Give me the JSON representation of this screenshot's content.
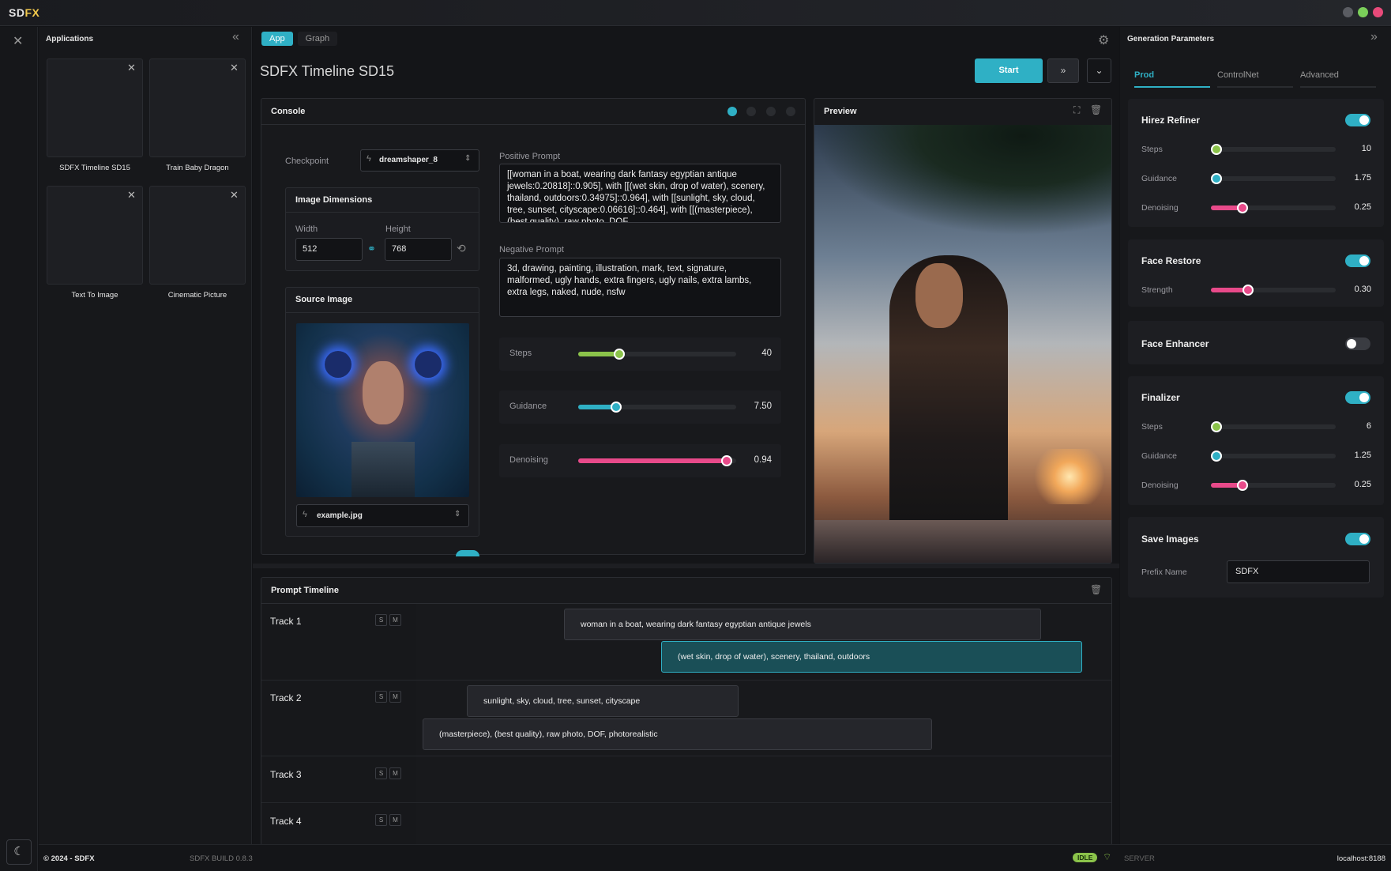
{
  "app": {
    "logo_sd": "SD",
    "logo_fx": "FX"
  },
  "window_controls": {
    "colors": [
      "#5a5c62",
      "#7bcf5a",
      "#e84a7a"
    ]
  },
  "applications": {
    "title": "Applications",
    "items": [
      {
        "label": "SDFX Timeline SD15"
      },
      {
        "label": "Train Baby Dragon"
      },
      {
        "label": "Text To Image"
      },
      {
        "label": "Cinematic Picture"
      }
    ]
  },
  "main": {
    "tabs": [
      {
        "label": "App"
      },
      {
        "label": "Graph"
      }
    ],
    "title": "SDFX Timeline SD15",
    "start_label": "Start"
  },
  "console": {
    "title": "Console",
    "checkpoint_label": "Checkpoint",
    "checkpoint_value": "dreamshaper_8",
    "image_dimensions": {
      "title": "Image Dimensions",
      "width_label": "Width",
      "width_value": "512",
      "height_label": "Height",
      "height_value": "768"
    },
    "source_image": {
      "title": "Source Image",
      "file": "example.jpg"
    },
    "positive_prompt": {
      "label": "Positive Prompt",
      "text": "[[woman in a boat, wearing dark fantasy egyptian antique jewels:0.20818]::0.905], with [[(wet skin, drop of water), scenery, thailand, outdoors:0.34975]::0.964], with [[sunlight, sky, cloud, tree, sunset, cityscape:0.06616]::0.464], with [[(masterpiece), (best quality), raw photo, DOF"
    },
    "negative_prompt": {
      "label": "Negative Prompt",
      "text": "3d, drawing, painting, illustration, mark, text, signature, malformed, ugly hands, extra fingers, ugly nails, extra lambs, extra legs, naked, nude, nsfw"
    },
    "sliders": [
      {
        "label": "Steps",
        "value": "40",
        "fraction": 0.26,
        "color": "#8bc34a"
      },
      {
        "label": "Guidance",
        "value": "7.50",
        "fraction": 0.24,
        "color": "#2fb0c5"
      },
      {
        "label": "Denoising",
        "value": "0.94",
        "fraction": 0.94,
        "color": "#e84a8a"
      }
    ]
  },
  "preview": {
    "title": "Preview"
  },
  "timeline": {
    "title": "Prompt Timeline",
    "tracks": [
      {
        "name": "Track 1",
        "s": "S",
        "m": "M",
        "clips": [
          "woman in a boat, wearing dark fantasy egyptian antique jewels",
          "(wet skin, drop of water), scenery, thailand, outdoors"
        ]
      },
      {
        "name": "Track 2",
        "s": "S",
        "m": "M",
        "clips": [
          "sunlight, sky, cloud, tree, sunset, cityscape",
          "(masterpiece), (best quality), raw photo, DOF, photorealistic"
        ]
      },
      {
        "name": "Track 3",
        "s": "S",
        "m": "M",
        "clips": []
      },
      {
        "name": "Track 4",
        "s": "S",
        "m": "M",
        "clips": []
      }
    ]
  },
  "generation": {
    "title": "Generation Parameters",
    "tabs": [
      {
        "label": "Prod"
      },
      {
        "label": "ControlNet"
      },
      {
        "label": "Advanced"
      }
    ],
    "hirez": {
      "title": "Hirez Refiner",
      "on": true,
      "sliders": [
        {
          "label": "Steps",
          "value": "10",
          "fraction": 0.0,
          "color": "#8bc34a"
        },
        {
          "label": "Guidance",
          "value": "1.75",
          "fraction": 0.0,
          "color": "#2fb0c5"
        },
        {
          "label": "Denoising",
          "value": "0.25",
          "fraction": 0.25,
          "color": "#e84a8a"
        }
      ]
    },
    "face_restore": {
      "title": "Face Restore",
      "on": true,
      "sliders": [
        {
          "label": "Strength",
          "value": "0.30",
          "fraction": 0.3,
          "color": "#e84a8a"
        }
      ]
    },
    "face_enhancer": {
      "title": "Face Enhancer",
      "on": false
    },
    "finalizer": {
      "title": "Finalizer",
      "on": true,
      "sliders": [
        {
          "label": "Steps",
          "value": "6",
          "fraction": 0.0,
          "color": "#8bc34a"
        },
        {
          "label": "Guidance",
          "value": "1.25",
          "fraction": 0.0,
          "color": "#2fb0c5"
        },
        {
          "label": "Denoising",
          "value": "0.25",
          "fraction": 0.25,
          "color": "#e84a8a"
        }
      ]
    },
    "save_images": {
      "title": "Save Images",
      "on": true,
      "prefix_label": "Prefix Name",
      "prefix_value": "SDFX"
    }
  },
  "footer": {
    "copyright": "© 2024 - SDFX",
    "build": "SDFX BUILD 0.8.3",
    "status": "IDLE",
    "server_label": "SERVER",
    "server_value": "localhost:8188"
  }
}
